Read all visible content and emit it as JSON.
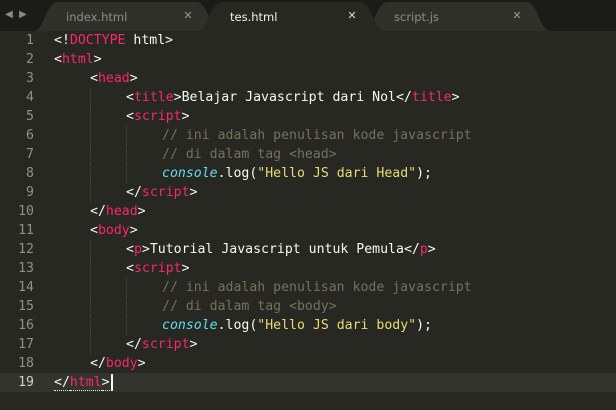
{
  "colors": {
    "background": "#272822",
    "tag": "#f92672",
    "comment": "#75715e",
    "string": "#e6db74",
    "object": "#66d9ef",
    "text": "#f8f8f2"
  },
  "tabs": [
    {
      "label": "index.html",
      "active": false
    },
    {
      "label": "tes.html",
      "active": true
    },
    {
      "label": "script.js",
      "active": false
    }
  ],
  "tab_close_glyph": "✕",
  "nav": {
    "left_icon": "triangle-left-icon",
    "right_icon": "triangle-right-icon",
    "left_glyph": "◀",
    "right_glyph": "▶"
  },
  "editor": {
    "current_line": 19,
    "lines": [
      {
        "n": "1",
        "indent": 0,
        "tokens": [
          [
            "p",
            "<!"
          ],
          [
            "tag",
            "DOCTYPE"
          ],
          [
            "t",
            " html"
          ],
          [
            "p",
            ">"
          ]
        ]
      },
      {
        "n": "2",
        "indent": 0,
        "tokens": [
          [
            "p",
            "<"
          ],
          [
            "tag",
            "html"
          ],
          [
            "p",
            ">"
          ]
        ]
      },
      {
        "n": "3",
        "indent": 1,
        "tokens": [
          [
            "p",
            "<"
          ],
          [
            "tag",
            "head"
          ],
          [
            "p",
            ">"
          ]
        ]
      },
      {
        "n": "4",
        "indent": 2,
        "tokens": [
          [
            "p",
            "<"
          ],
          [
            "tag",
            "title"
          ],
          [
            "p",
            ">"
          ],
          [
            "t",
            "Belajar Javascript dari Nol"
          ],
          [
            "p",
            "</"
          ],
          [
            "tag",
            "title"
          ],
          [
            "p",
            ">"
          ]
        ]
      },
      {
        "n": "5",
        "indent": 2,
        "tokens": [
          [
            "p",
            "<"
          ],
          [
            "tag",
            "script"
          ],
          [
            "p",
            ">"
          ]
        ]
      },
      {
        "n": "6",
        "indent": 3,
        "tokens": [
          [
            "c",
            "// ini adalah penulisan kode javascript"
          ]
        ]
      },
      {
        "n": "7",
        "indent": 3,
        "tokens": [
          [
            "c",
            "// di dalam tag <head>"
          ]
        ]
      },
      {
        "n": "8",
        "indent": 3,
        "tokens": [
          [
            "o",
            "console"
          ],
          [
            "p",
            "."
          ],
          [
            "t",
            "log("
          ],
          [
            "s",
            "\"Hello JS dari Head\""
          ],
          [
            "t",
            ");"
          ]
        ]
      },
      {
        "n": "9",
        "indent": 2,
        "tokens": [
          [
            "p",
            "</"
          ],
          [
            "tag",
            "script"
          ],
          [
            "p",
            ">"
          ]
        ]
      },
      {
        "n": "10",
        "indent": 1,
        "tokens": [
          [
            "p",
            "</"
          ],
          [
            "tag",
            "head"
          ],
          [
            "p",
            ">"
          ]
        ]
      },
      {
        "n": "11",
        "indent": 1,
        "tokens": [
          [
            "p",
            "<"
          ],
          [
            "tag",
            "body"
          ],
          [
            "p",
            ">"
          ]
        ]
      },
      {
        "n": "12",
        "indent": 2,
        "tokens": [
          [
            "p",
            "<"
          ],
          [
            "tag",
            "p"
          ],
          [
            "p",
            ">"
          ],
          [
            "t",
            "Tutorial Javascript untuk Pemula"
          ],
          [
            "p",
            "</"
          ],
          [
            "tag",
            "p"
          ],
          [
            "p",
            ">"
          ]
        ]
      },
      {
        "n": "13",
        "indent": 2,
        "tokens": [
          [
            "p",
            "<"
          ],
          [
            "tag",
            "script"
          ],
          [
            "p",
            ">"
          ]
        ]
      },
      {
        "n": "14",
        "indent": 3,
        "tokens": [
          [
            "c",
            "// ini adalah penulisan kode javascript"
          ]
        ]
      },
      {
        "n": "15",
        "indent": 3,
        "tokens": [
          [
            "c",
            "// di dalam tag <body>"
          ]
        ]
      },
      {
        "n": "16",
        "indent": 3,
        "tokens": [
          [
            "o",
            "console"
          ],
          [
            "p",
            "."
          ],
          [
            "t",
            "log("
          ],
          [
            "s",
            "\"Hello JS dari body\""
          ],
          [
            "t",
            ");"
          ]
        ]
      },
      {
        "n": "17",
        "indent": 2,
        "tokens": [
          [
            "p",
            "</"
          ],
          [
            "tag",
            "script"
          ],
          [
            "p",
            ">"
          ]
        ]
      },
      {
        "n": "18",
        "indent": 1,
        "tokens": [
          [
            "p",
            "</"
          ],
          [
            "tag",
            "body"
          ],
          [
            "p",
            ">"
          ]
        ]
      },
      {
        "n": "19",
        "indent": 0,
        "tokens": [
          [
            "pu",
            "</"
          ],
          [
            "tagu",
            "html"
          ],
          [
            "pu",
            ">"
          ]
        ]
      }
    ]
  }
}
